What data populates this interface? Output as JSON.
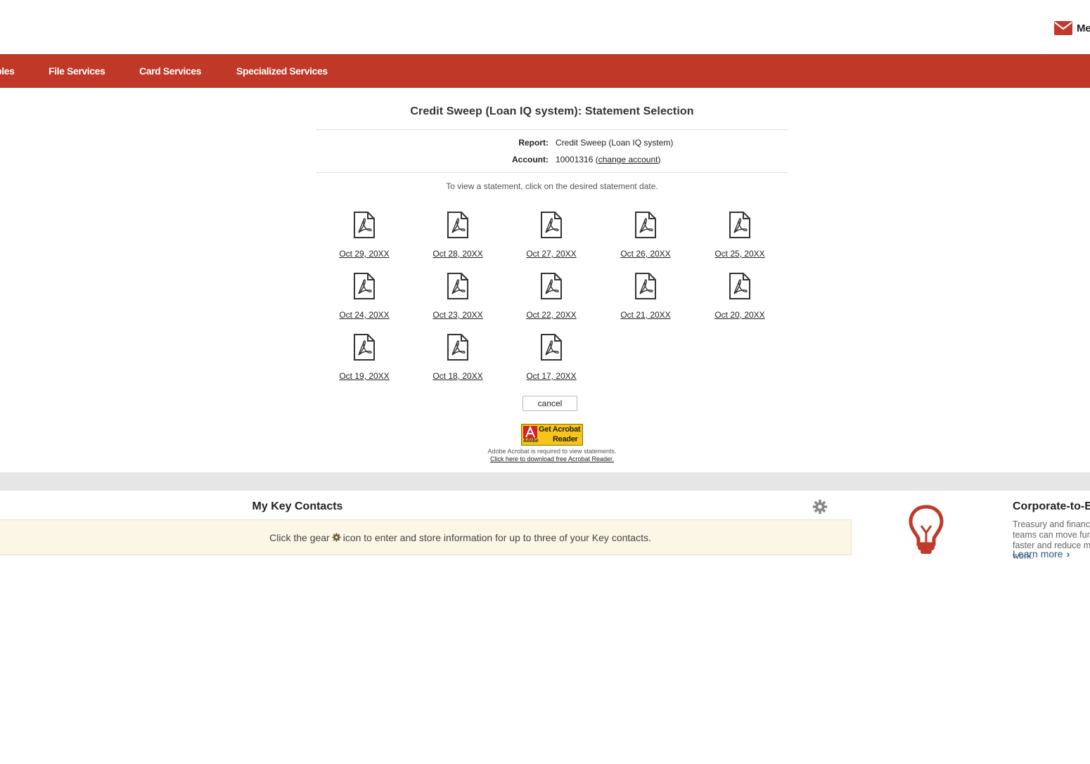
{
  "header": {
    "messages_label": "Messages"
  },
  "nav": {
    "items": [
      {
        "label": "Payables"
      },
      {
        "label": "File Services"
      },
      {
        "label": "Card Services"
      },
      {
        "label": "Specialized Services"
      }
    ]
  },
  "page": {
    "title": "Credit Sweep (Loan IQ system): Statement Selection",
    "report_label": "Report:",
    "report_value": "Credit Sweep (Loan IQ system)",
    "account_label": "Account:",
    "account_number": "10001316 (",
    "change_account_link": "change account",
    "account_close": ")",
    "instructions": "To view a statement, click on the desired statement date.",
    "statements": [
      {
        "date": "Oct 29, 20XX",
        "icon": "pdf-icon"
      },
      {
        "date": "Oct 28, 20XX",
        "icon": "pdf-icon"
      },
      {
        "date": "Oct 27, 20XX",
        "icon": "pdf-icon"
      },
      {
        "date": "Oct 26, 20XX",
        "icon": "pdf-icon"
      },
      {
        "date": "Oct 25, 20XX",
        "icon": "pdf-icon"
      },
      {
        "date": "Oct 24, 20XX",
        "icon": "pdf-icon"
      },
      {
        "date": "Oct 23, 20XX",
        "icon": "pdf-icon"
      },
      {
        "date": "Oct 22, 20XX",
        "icon": "pdf-icon"
      },
      {
        "date": "Oct 21, 20XX",
        "icon": "pdf-icon"
      },
      {
        "date": "Oct 20, 20XX",
        "icon": "pdf-icon"
      },
      {
        "date": "Oct 19, 20XX",
        "icon": "pdf-icon"
      },
      {
        "date": "Oct 18, 20XX",
        "icon": "pdf-icon"
      },
      {
        "date": "Oct 17, 20XX",
        "icon": "pdf-icon"
      }
    ],
    "cancel_label": "cancel",
    "acrobat": {
      "badge_get": "Get Acrobat",
      "badge_reader": "Reader",
      "badge_adobe": "Adobe",
      "note": "Adobe Acrobat is required to view statements.",
      "download_link": "Click here to download free Acrobat Reader."
    }
  },
  "key_contacts": {
    "title": "My Key Contacts",
    "message_before": "Click the gear",
    "message_after": "icon to enter and store information for up to three of your Key contacts."
  },
  "promo": {
    "title": "Corporate-to-Bank",
    "description": "Treasury and finance teams can move funds faster and reduce manual work.",
    "link_label": "Learn more"
  },
  "colors": {
    "brand_red": "#bf3828",
    "promo_link": "#2a5788",
    "notice_bg": "#fbf6e6",
    "band_gray": "#e6e6e6"
  }
}
